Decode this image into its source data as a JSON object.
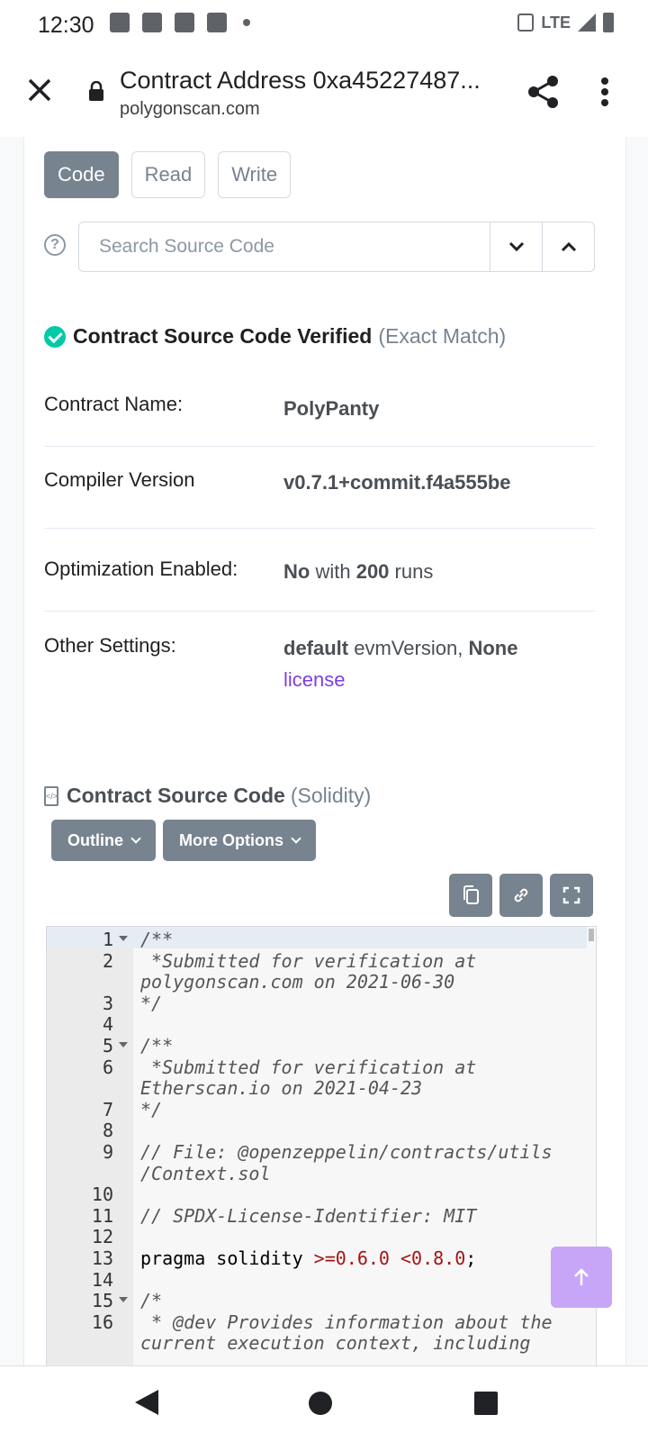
{
  "status_bar": {
    "time": "12:30",
    "network": "LTE"
  },
  "browser": {
    "title": "Contract Address 0xa45227487...",
    "domain": "polygonscan.com"
  },
  "tabs": [
    {
      "label": "Code",
      "active": true
    },
    {
      "label": "Read",
      "active": false
    },
    {
      "label": "Write",
      "active": false
    }
  ],
  "search": {
    "placeholder": "Search Source Code"
  },
  "verified": {
    "title": "Contract Source Code Verified",
    "subtitle": "(Exact Match)"
  },
  "details": {
    "contract_name_label": "Contract Name:",
    "contract_name_value": "PolyPanty",
    "compiler_label": "Compiler Version",
    "compiler_value": "v0.7.1+commit.f4a555be",
    "optimization_label": "Optimization Enabled:",
    "optimization_no": "No",
    "optimization_with": "with",
    "optimization_runs_num": "200",
    "optimization_runs": "runs",
    "other_label": "Other Settings:",
    "other_default": "default",
    "other_evm": "evmVersion,",
    "other_none": "None",
    "other_license": "license"
  },
  "source": {
    "title": "Contract Source Code",
    "language": "(Solidity)",
    "outline_label": "Outline",
    "more_options_label": "More Options"
  },
  "code_lines": [
    {
      "num": "1",
      "text": "/**"
    },
    {
      "num": "2",
      "text": " *Submitted for verification at"
    },
    {
      "num": "",
      "text": "polygonscan.com on 2021-06-30"
    },
    {
      "num": "3",
      "text": "*/"
    },
    {
      "num": "4",
      "text": ""
    },
    {
      "num": "5",
      "text": "/**"
    },
    {
      "num": "6",
      "text": " *Submitted for verification at"
    },
    {
      "num": "",
      "text": "Etherscan.io on 2021-04-23"
    },
    {
      "num": "7",
      "text": "*/"
    },
    {
      "num": "8",
      "text": ""
    },
    {
      "num": "9",
      "text": "// File: @openzeppelin/contracts/utils"
    },
    {
      "num": "",
      "text": "/Context.sol"
    },
    {
      "num": "10",
      "text": ""
    },
    {
      "num": "11",
      "text": "// SPDX-License-Identifier: MIT"
    },
    {
      "num": "12",
      "text": ""
    },
    {
      "num": "13",
      "text": "pragma solidity >=0.6.0 <0.8.0;"
    },
    {
      "num": "14",
      "text": ""
    },
    {
      "num": "15",
      "text": "/*"
    },
    {
      "num": "16",
      "text": " * @dev Provides information about the"
    },
    {
      "num": "",
      "text": "current execution context, including"
    }
  ]
}
